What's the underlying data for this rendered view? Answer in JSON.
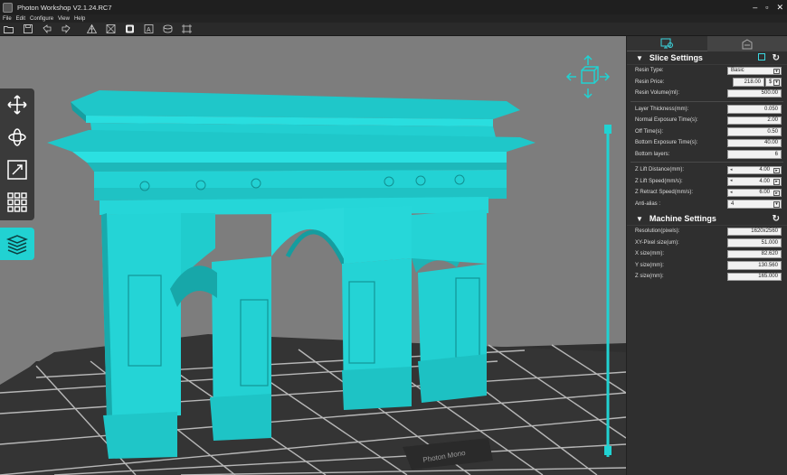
{
  "window": {
    "title": "Photon Workshop V2.1.24.RC7",
    "controls": [
      "–",
      "▫",
      "✕"
    ]
  },
  "menu": [
    "File",
    "Edit",
    "Configure",
    "View",
    "Help"
  ],
  "toolbar": [
    "open-folder-icon",
    "save-icon",
    "undo-icon",
    "redo-icon",
    "support-icon",
    "hollow-icon",
    "fill-icon",
    "text-icon",
    "cylinder-icon",
    "frame-icon"
  ],
  "viewport": {
    "plate_label": "Photon Mono",
    "accent": "#21d2d2",
    "background": "#7d7d7d"
  },
  "panel": {
    "tabs": [
      "slice-settings-tab",
      "machine-tab"
    ],
    "slice": {
      "title": "Slice Settings",
      "resin_type": {
        "label": "Resin Type:",
        "value": "Basic"
      },
      "resin_price": {
        "label": "Resin Price:",
        "value": "218.00",
        "currency": "$"
      },
      "resin_volume": {
        "label": "Resin Volume(ml):",
        "value": "500.00"
      },
      "layer_thickness": {
        "label": "Layer Thickness(mm):",
        "value": "0.050"
      },
      "normal_exposure": {
        "label": "Normal Exposure Time(s):",
        "value": "2.00"
      },
      "off_time": {
        "label": "Off Time(s):",
        "value": "0.50"
      },
      "bottom_exposure": {
        "label": "Bottom Exposure Time(s):",
        "value": "40.00"
      },
      "bottom_layers": {
        "label": "Bottom layers:",
        "value": "6"
      },
      "z_lift_distance": {
        "label": "Z Lift Distance(mm):",
        "value": "4.00"
      },
      "z_lift_speed": {
        "label": "Z Lift Speed(mm/s):",
        "value": "4.00"
      },
      "z_retract_speed": {
        "label": "Z Retract Speed(mm/s):",
        "value": "6.00"
      },
      "anti_alias": {
        "label": "Anti-alias :",
        "value": "4"
      }
    },
    "machine": {
      "title": "Machine Settings",
      "resolution": {
        "label": "Resolution(pixels):",
        "value": "1620x2560"
      },
      "xy_pixel": {
        "label": "XY-Pixel size(um):",
        "value": "51.000"
      },
      "x_size": {
        "label": "X size(mm):",
        "value": "82.620"
      },
      "y_size": {
        "label": "Y size(mm):",
        "value": "130.560"
      },
      "z_size": {
        "label": "Z size(mm):",
        "value": "165.000"
      }
    }
  }
}
